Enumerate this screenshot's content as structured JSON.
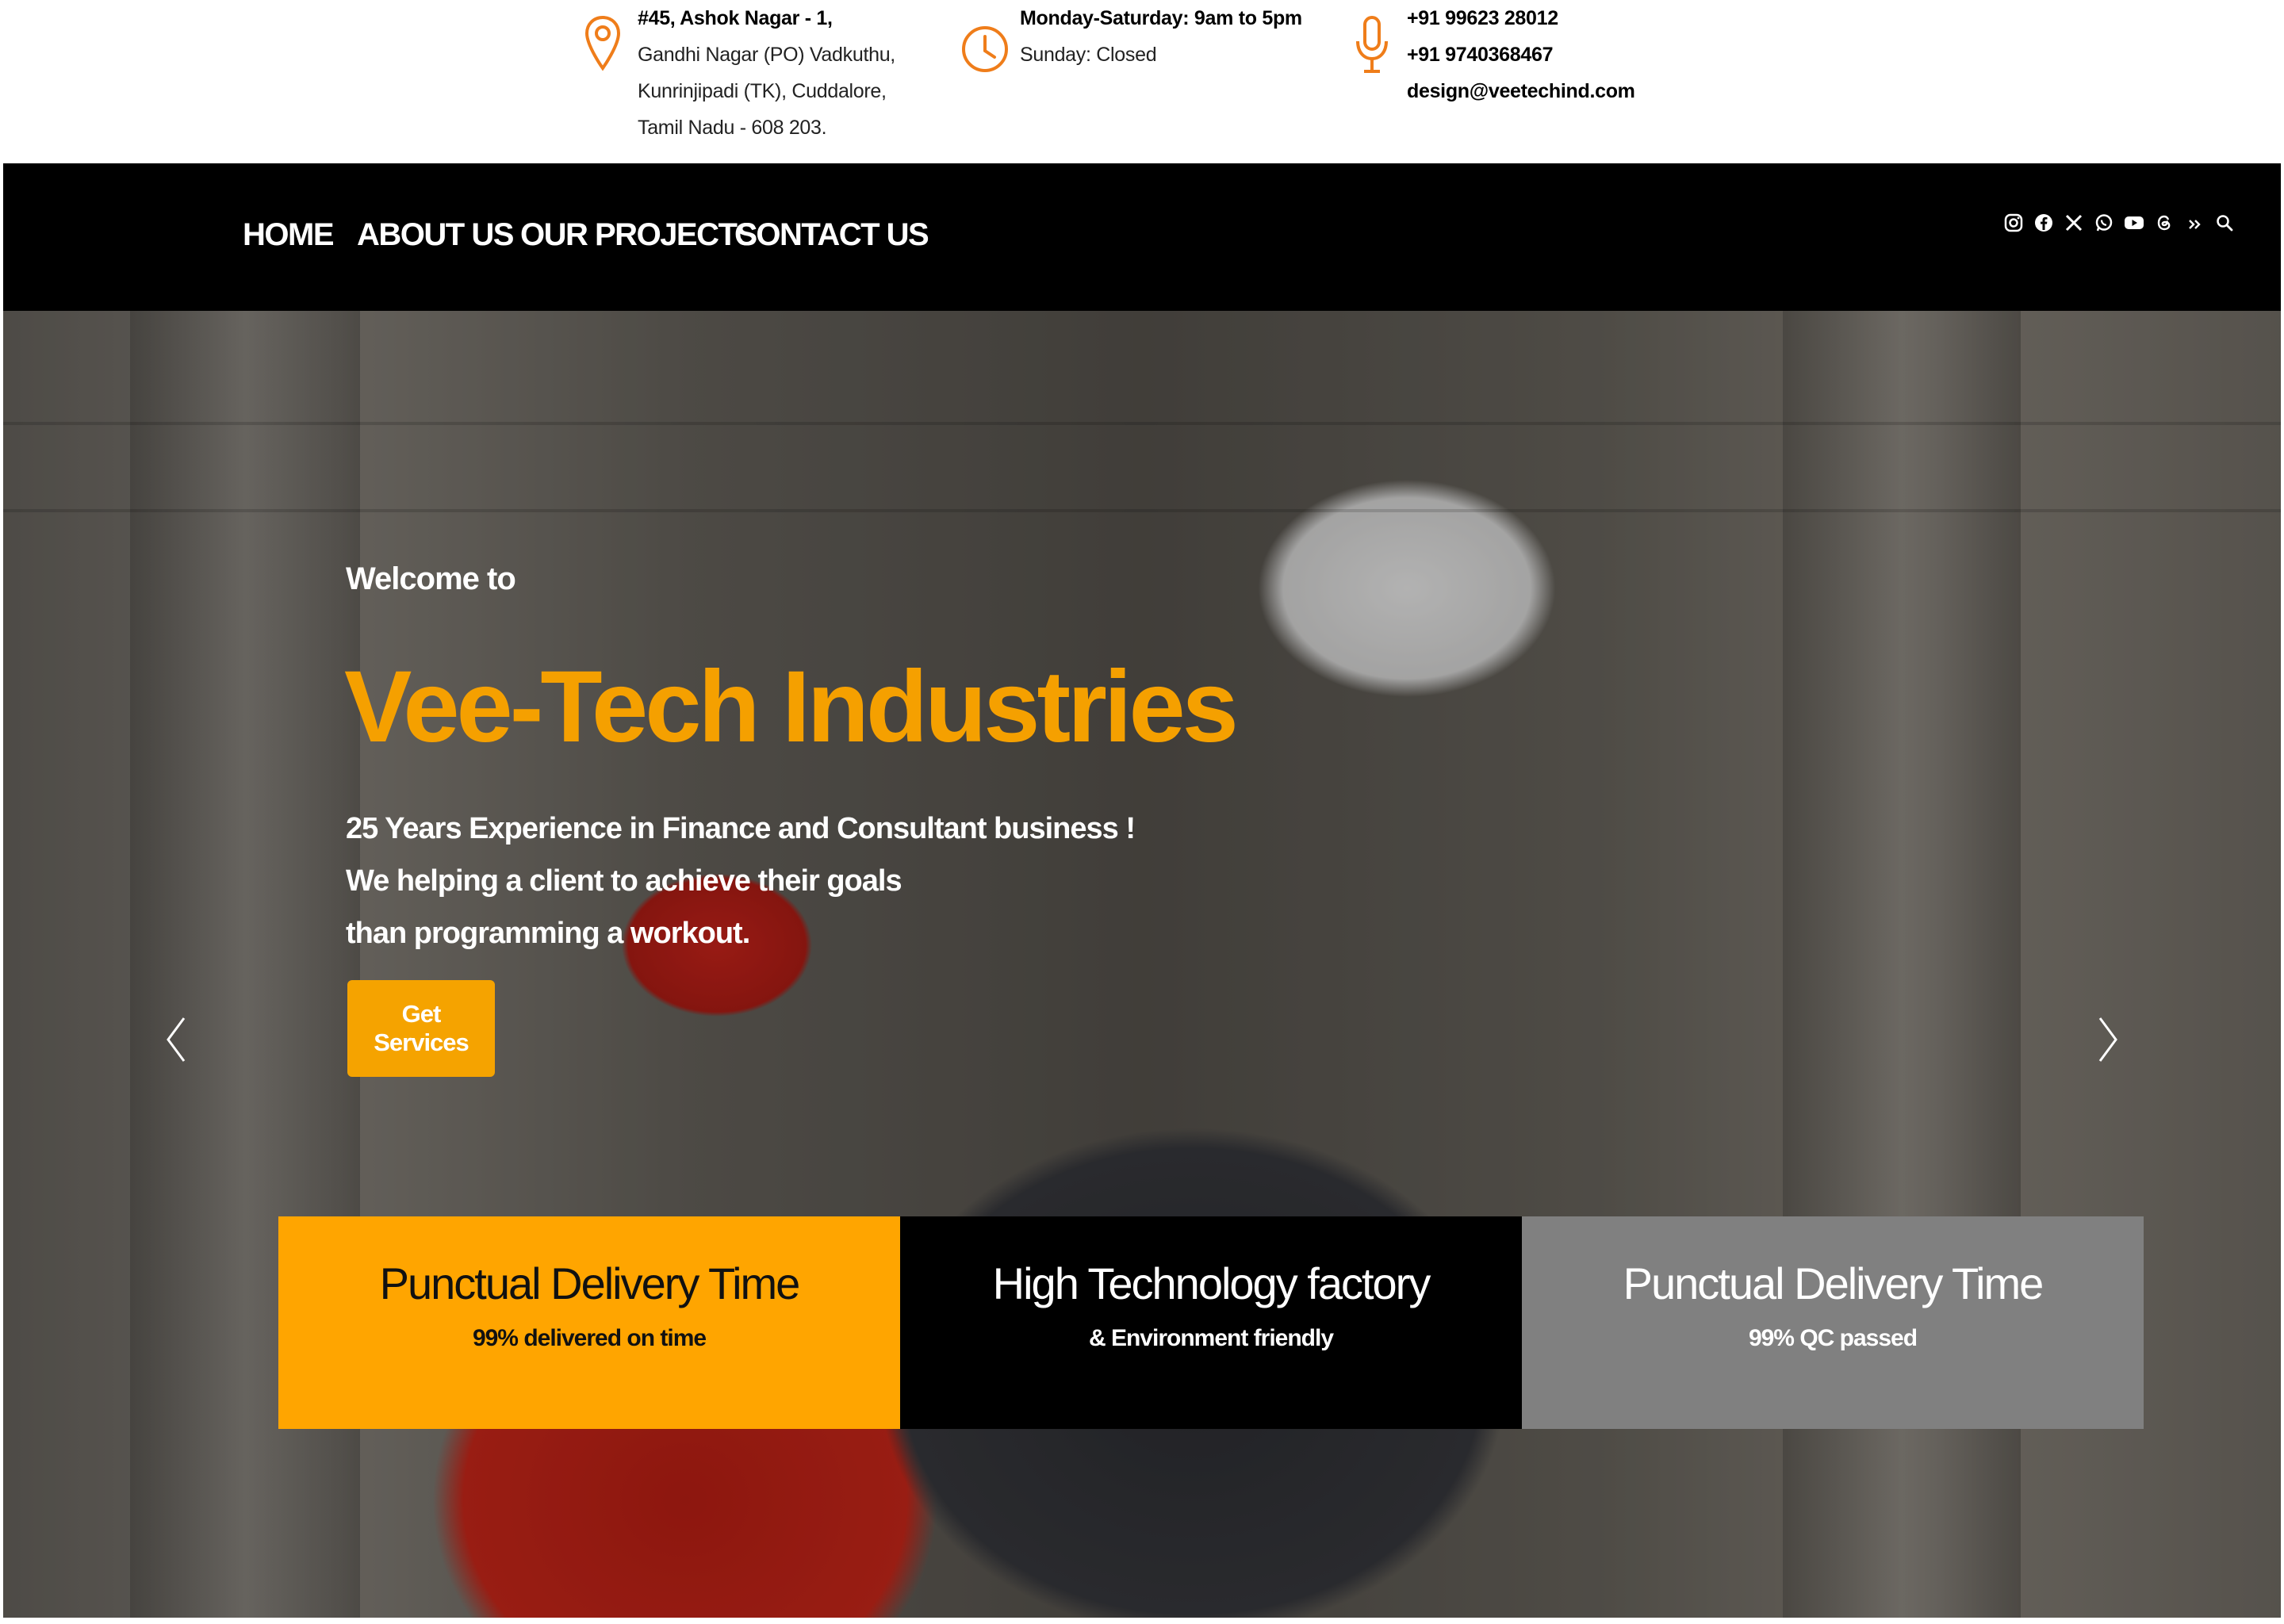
{
  "topbar": {
    "address": {
      "icon": "location-pin-icon",
      "lines": [
        "#45, Ashok Nagar - 1,",
        "Gandhi Nagar (PO) Vadkuthu,",
        "Kunrinjipadi (TK), Cuddalore,",
        "Tamil Nadu - 608 203."
      ]
    },
    "hours": {
      "icon": "clock-icon",
      "lines": [
        "Monday-Saturday: 9am to 5pm",
        "Sunday: Closed"
      ]
    },
    "contact": {
      "icon": "microphone-icon",
      "lines": [
        "+91 99623 28012",
        "+91 9740368467",
        "design@veetechind.com"
      ]
    },
    "accent_color": "#ef7d1a"
  },
  "nav": {
    "items": [
      "HOME",
      "ABOUT US",
      "OUR PROJECTS",
      "CONTACT US"
    ],
    "social_icons": [
      "instagram-icon",
      "facebook-icon",
      "x-icon",
      "whatsapp-icon",
      "youtube-icon",
      "threads-icon",
      "double-chevron-icon",
      "search-icon"
    ]
  },
  "hero": {
    "welcome": "Welcome to",
    "title": "Vee-Tech Industries",
    "subtitle_lines": [
      "25 Years Experience in Finance and Consultant business !",
      "We helping a client to achieve their goals",
      "than programming a workout."
    ],
    "cta": "Get Services",
    "title_color": "#f5a000",
    "cta_color": "#f5a300"
  },
  "features": [
    {
      "heading": "Punctual Delivery Time",
      "text": "99% delivered on time",
      "bg": "#ffa500",
      "fg": "#111111"
    },
    {
      "heading": "High Technology factory",
      "text": "& Environment friendly",
      "bg": "#000000",
      "fg": "#ffffff"
    },
    {
      "heading": "Punctual Delivery Time",
      "text": "99% QC passed",
      "bg": "#808080",
      "fg": "#ffffff"
    }
  ]
}
